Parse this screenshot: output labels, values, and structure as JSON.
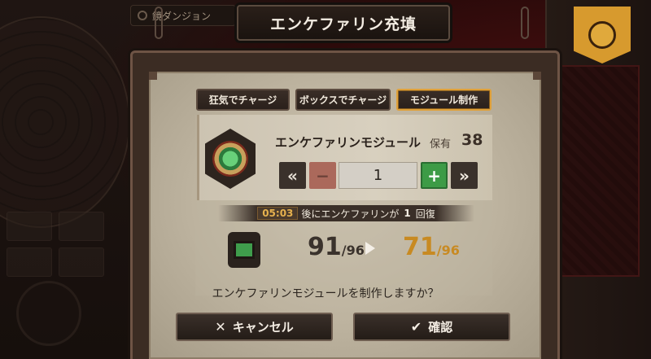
{
  "header": {
    "title": "エンケファリン充填",
    "side_tab": "鏡ダンジョン"
  },
  "tabs": [
    {
      "label": "狂気でチャージ",
      "active": false
    },
    {
      "label": "ボックスでチャージ",
      "active": false
    },
    {
      "label": "モジュール制作",
      "active": true
    }
  ],
  "module": {
    "name": "エンケファリンモジュール",
    "owned_label": "保有",
    "owned_value": "38",
    "icon": "enkephalin-module-icon"
  },
  "stepper": {
    "quantity": "1",
    "min_symbol": "«",
    "minus_symbol": "−",
    "plus_symbol": "+",
    "max_symbol": "»"
  },
  "recovery": {
    "time": "05:03",
    "text_before": "後にエンケファリンが",
    "amount": "1",
    "text_after": "回復"
  },
  "energy": {
    "current": "91",
    "after": "71",
    "max": "/96"
  },
  "prompt": "エンケファリンモジュールを制作しますか？",
  "buttons": {
    "cancel_icon": "✕",
    "cancel_label": "キャンセル",
    "confirm_icon": "✔",
    "confirm_label": "確認"
  },
  "colors": {
    "accent_gold": "#e0a13a",
    "plus_green": "#3d9b46",
    "after_value": "#c88a22"
  }
}
